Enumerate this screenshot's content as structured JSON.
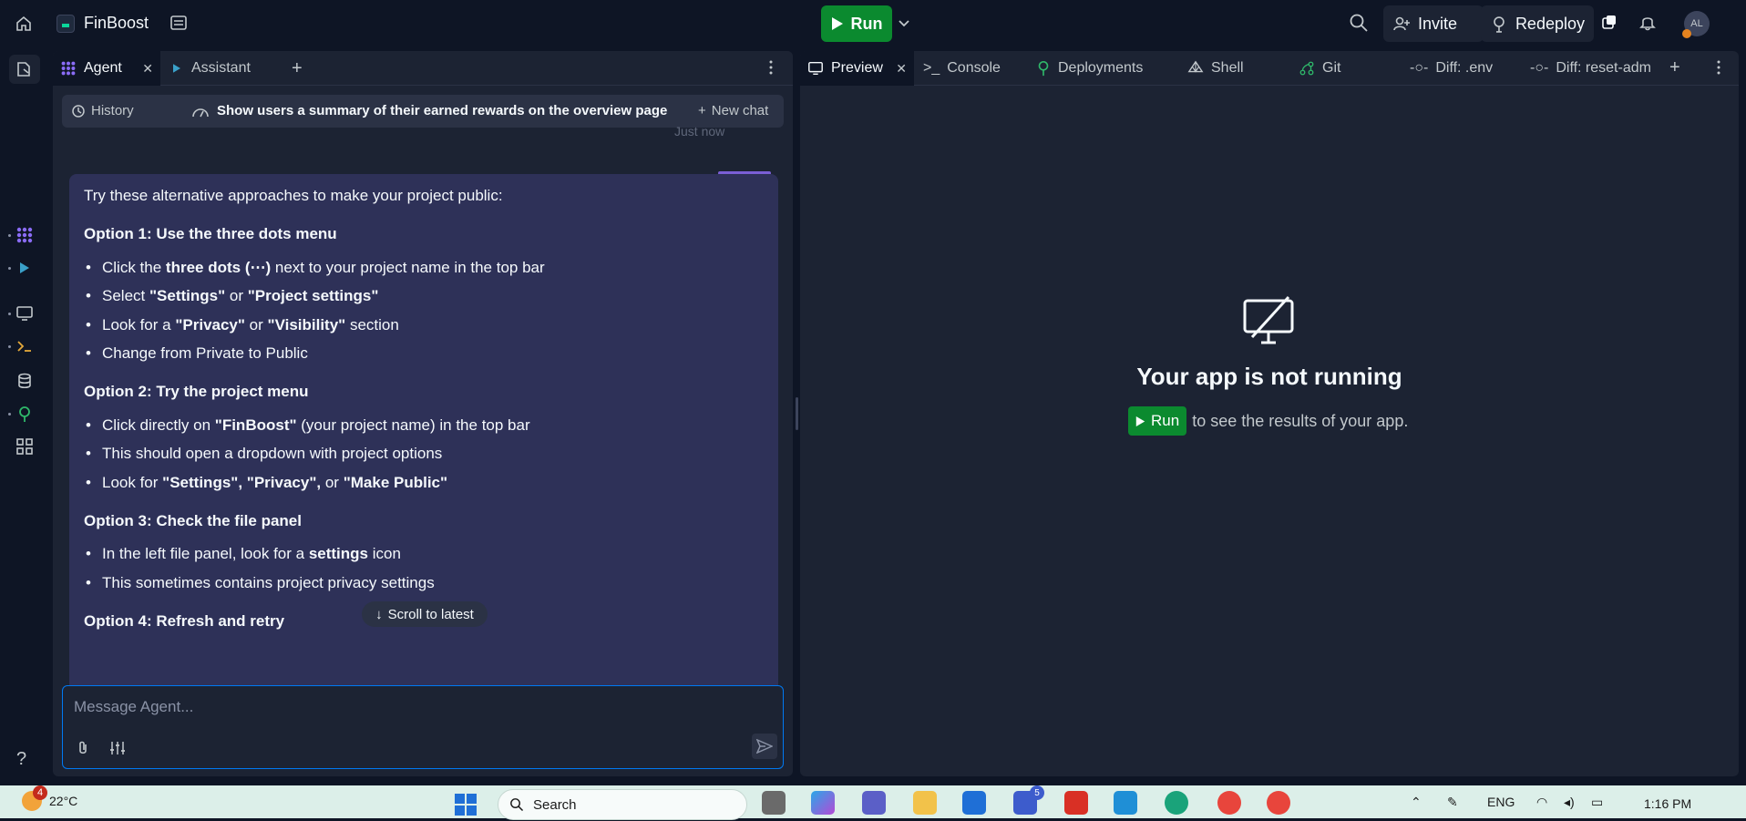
{
  "topbar": {
    "project_name": "FinBoost",
    "run_label": "Run",
    "invite_label": "Invite",
    "redeploy_label": "Redeploy",
    "avatar_initials": "AL"
  },
  "left_tabs": [
    {
      "label": "Agent",
      "active": true
    },
    {
      "label": "Assistant",
      "active": false
    }
  ],
  "chat": {
    "history_label": "History",
    "title": "Show users a summary of their earned rewards on the overview page",
    "new_chat_label": "New chat",
    "timestamp": "Just now",
    "intro": "Try these alternative approaches to make your project public:",
    "option1_title": "Option 1: Use the three dots menu",
    "option1_items": [
      [
        "Click the ",
        "three dots (⋯)",
        " next to your project name in the top bar"
      ],
      [
        "Select ",
        "\"Settings\"",
        " or ",
        "\"Project settings\""
      ],
      [
        "Look for a ",
        "\"Privacy\"",
        " or ",
        "\"Visibility\"",
        " section"
      ],
      [
        "Change from Private to Public"
      ]
    ],
    "option2_title": "Option 2: Try the project menu",
    "option2_items": [
      [
        "Click directly on ",
        "\"FinBoost\"",
        " (your project name) in the top bar"
      ],
      [
        "This should open a dropdown with project options"
      ],
      [
        "Look for ",
        "\"Settings\", \"Privacy\",",
        " or ",
        "\"Make Public\""
      ]
    ],
    "option3_title": "Option 3: Check the file panel",
    "option3_items": [
      [
        "In the left file panel, look for a ",
        "settings",
        " icon"
      ],
      [
        "This sometimes contains project privacy settings"
      ]
    ],
    "option4_title_partial": "Option 4: Refresh and retry",
    "scroll_label": "Scroll to latest",
    "input_placeholder": "Message Agent..."
  },
  "right_tabs": [
    {
      "label": "Preview",
      "active": true,
      "icon": "monitor-icon"
    },
    {
      "label": "Console",
      "active": false,
      "icon": "terminal-icon"
    },
    {
      "label": "Deployments",
      "active": false,
      "icon": "deploy-icon"
    },
    {
      "label": "Shell",
      "active": false,
      "icon": "shell-icon"
    },
    {
      "label": "Git",
      "active": false,
      "icon": "git-icon"
    },
    {
      "label": "Diff: .env",
      "active": false,
      "icon": "diff-icon"
    },
    {
      "label": "Diff: reset-adm",
      "active": false,
      "icon": "diff-icon"
    }
  ],
  "preview": {
    "title": "Your app is not running",
    "run_label": "Run",
    "hint": "to see the results of your app."
  },
  "taskbar": {
    "weather_temp": "22°C",
    "weather_badge": "4",
    "search_placeholder": "Search",
    "teams_badge": "5",
    "language": "ENG",
    "time": "1:16 PM"
  },
  "colors": {
    "run_green": "#0b8a2f",
    "message_bg": "#2e3158",
    "composer_border": "#0079f2"
  }
}
